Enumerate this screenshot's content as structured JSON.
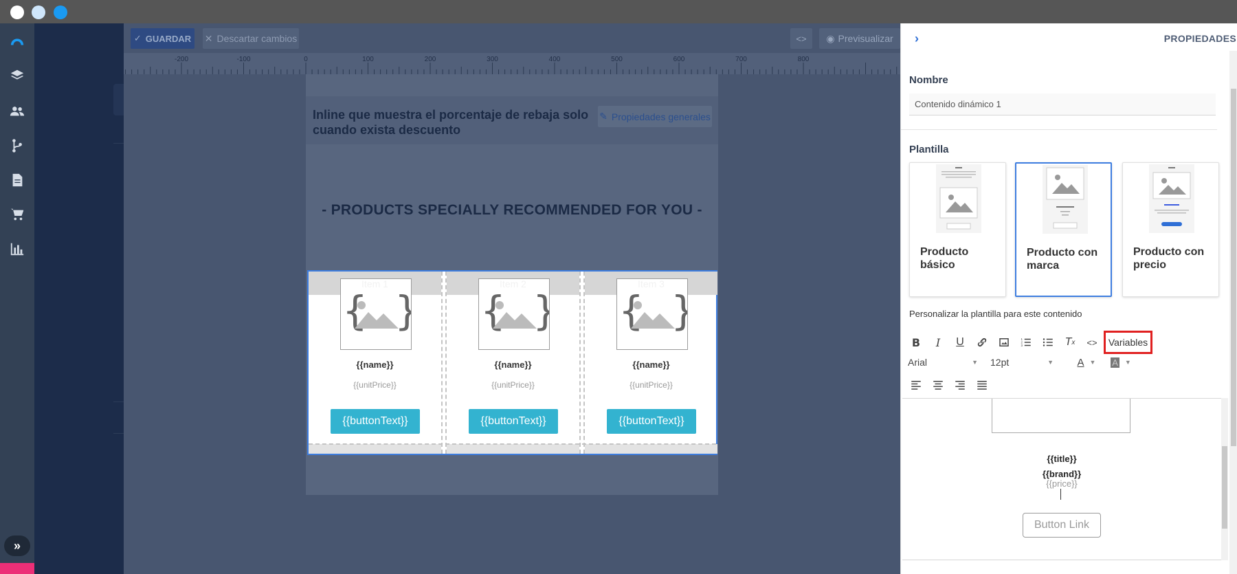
{
  "toolbar": {
    "save_label": "GUARDAR",
    "discard_label": "Descartar cambios",
    "code_label": "<>",
    "preview_label": "Previsualizar"
  },
  "ruler": {
    "ticks": [
      "-200",
      "-100",
      "0",
      "100",
      "200",
      "300",
      "400",
      "500",
      "600",
      "700",
      "800"
    ]
  },
  "email": {
    "title": "Inline que muestra el porcentaje de rebaja solo cuando exista descuento",
    "general_props_label": "Propiedades generales",
    "heading": "- PRODUCTS SPECIALLY RECOMMENDED FOR YOU -",
    "items": [
      {
        "label": "Item 1",
        "name": "{{name}}",
        "price": "{{unitPrice}}",
        "button": "{{buttonText}}"
      },
      {
        "label": "Item 2",
        "name": "{{name}}",
        "price": "{{unitPrice}}",
        "button": "{{buttonText}}"
      },
      {
        "label": "Item 3",
        "name": "{{name}}",
        "price": "{{unitPrice}}",
        "button": "{{buttonText}}"
      }
    ]
  },
  "panel": {
    "title": "PROPIEDADES",
    "name_label": "Nombre",
    "name_value": "Contenido dinámico 1",
    "template_label": "Plantilla",
    "templates": [
      {
        "label": "Producto básico",
        "selected": false
      },
      {
        "label": "Producto con marca",
        "selected": true
      },
      {
        "label": "Producto con precio",
        "selected": false
      }
    ],
    "customize_label": "Personalizar la plantilla para este contenido",
    "variables_label": "Variables",
    "font_value": "Arial",
    "size_value": "12pt",
    "editor": {
      "title": "{{title}}",
      "brand": "{{brand}}",
      "price": "{{price}}",
      "button": "Button Link"
    }
  },
  "colors": {
    "accent": "#3d7de0",
    "product_button": "#33b3d0",
    "highlight": "#e02020",
    "user_badge": "#ec2f77"
  }
}
